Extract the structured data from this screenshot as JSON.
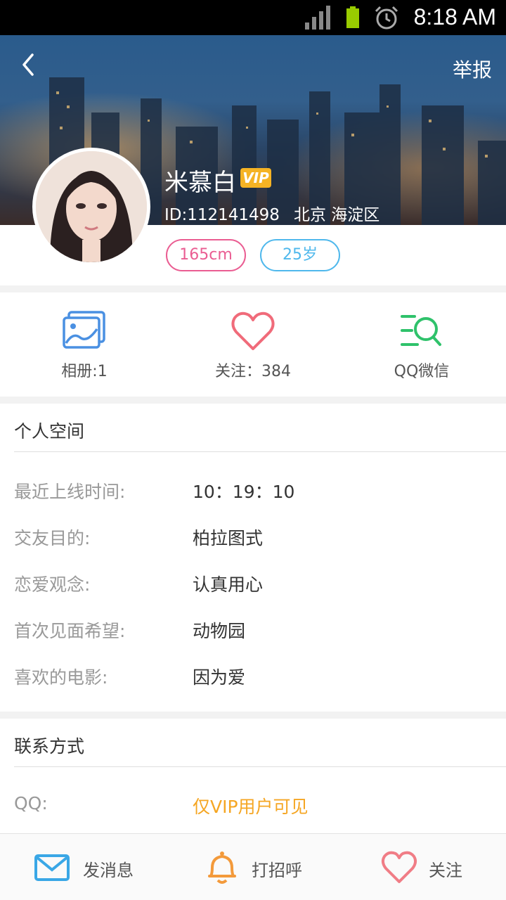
{
  "status_bar": {
    "time": "8:18 AM"
  },
  "header": {
    "report_label": "举报",
    "nickname": "米慕白",
    "vip_label": "VIP",
    "id_text": "ID:112141498",
    "location": "北京 海淀区",
    "tags": {
      "height": "165cm",
      "age": "25岁"
    }
  },
  "stats": [
    {
      "label": "相册:1",
      "icon": "album-icon",
      "color": "#4a90e2"
    },
    {
      "label": "关注：384",
      "icon": "heart-icon",
      "color": "#f06b7a"
    },
    {
      "label": "QQ微信",
      "icon": "search-list-icon",
      "color": "#2fc26b"
    }
  ],
  "personal_space": {
    "title": "个人空间",
    "rows": [
      {
        "key": "最近上线时间:",
        "value": "10：19：10"
      },
      {
        "key": "交友目的:",
        "value": "柏拉图式"
      },
      {
        "key": "恋爱观念:",
        "value": "认真用心"
      },
      {
        "key": "首次见面希望:",
        "value": "动物园"
      },
      {
        "key": "喜欢的电影:",
        "value": "因为爱"
      }
    ]
  },
  "contact": {
    "title": "联系方式",
    "rows": [
      {
        "key": "QQ:",
        "value": "仅VIP用户可见"
      }
    ]
  },
  "bottom_bar": {
    "message_label": "发消息",
    "greet_label": "打招呼",
    "follow_label": "关注"
  }
}
